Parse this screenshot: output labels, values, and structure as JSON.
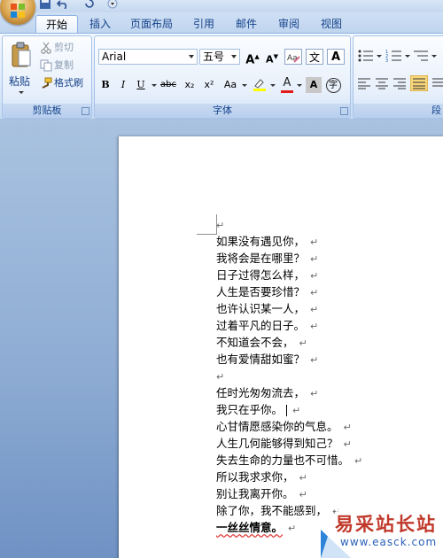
{
  "tabs": [
    "开始",
    "插入",
    "页面布局",
    "引用",
    "邮件",
    "审阅",
    "视图"
  ],
  "clipboard": {
    "paste_label": "粘贴",
    "cut_label": "剪切",
    "copy_label": "复制",
    "format_painter_label": "格式刷",
    "group_label": "剪贴板"
  },
  "font": {
    "font_name": "Arial",
    "font_size": "五号",
    "group_label": "字体",
    "grow_label": "A",
    "shrink_label": "A",
    "wen_label": "文",
    "bold_label": "B",
    "italic_label": "I",
    "underline_label": "U",
    "strike_label": "abc",
    "sub_label": "x₂",
    "sup_label": "x²",
    "case_label": "Aa",
    "color_label": "A",
    "shade_label": "A",
    "char_border_label": "字"
  },
  "paragraph": {
    "group_label": "段"
  },
  "document": {
    "lines": [
      "如果没有遇见你，",
      "我将会是在哪里？",
      "日子过得怎么样，",
      "人生是否要珍惜？",
      "也许认识某一人，",
      "过着平凡的日子。",
      "不知道会不会，",
      "也有爱情甜如蜜？",
      "",
      "任时光匆匆流去，",
      "我只在乎你。",
      "心甘情愿感染你的气息。",
      "人生几何能够得到知己？",
      "失去生命的力量也不可惜。",
      "所以我求求你，",
      "别让我离开你。",
      "除了你，我不能感到，",
      "一丝丝情意。"
    ],
    "paragraph_mark": "↵"
  },
  "watermark": {
    "text": "易采站长站",
    "url": "www.easck.com"
  },
  "colors": {
    "font_color_bar": "#e21b1b",
    "highlight_bar": "#ffff00",
    "spell_error": "#e03a3a"
  }
}
